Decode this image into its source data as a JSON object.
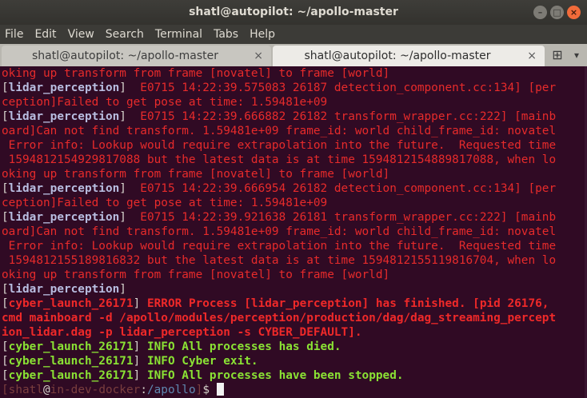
{
  "window": {
    "title": "shatl@autopilot: ~/apollo-master",
    "controls": {
      "minimize": "–",
      "maximize": "□",
      "close": "×"
    }
  },
  "menu": [
    "File",
    "Edit",
    "View",
    "Search",
    "Terminal",
    "Tabs",
    "Help"
  ],
  "tabs": [
    {
      "label": "shatl@autopilot: ~/apollo-master",
      "active": false
    },
    {
      "label": "shatl@autopilot: ~/apollo-master",
      "active": true
    }
  ],
  "tab_close_glyph": "×",
  "new_tab_glyph": "⊞",
  "tab_menu_glyph": "▾",
  "terminal": {
    "lines": [
      {
        "type": "red",
        "text": "oking up transform from frame [novatel] to frame [world]"
      },
      {
        "type": "tagged",
        "tag": "lidar_perception",
        "text": "  E0715 14:22:39.575083 26187 detection_component.cc:134] [per"
      },
      {
        "type": "red",
        "text": "ception]Failed to get pose at time: 1.59481e+09"
      },
      {
        "type": "tagged",
        "tag": "lidar_perception",
        "text": "  E0715 14:22:39.666882 26182 transform_wrapper.cc:222] [mainb"
      },
      {
        "type": "red",
        "text": "oard]Can not find transform. 1.59481e+09 frame_id: world child_frame_id: novatel"
      },
      {
        "type": "red",
        "text": " Error info: Lookup would require extrapolation into the future.  Requested time"
      },
      {
        "type": "red",
        "text": " 1594812154929817088 but the latest data is at time 1594812154889817088, when lo"
      },
      {
        "type": "red",
        "text": "oking up transform from frame [novatel] to frame [world]"
      },
      {
        "type": "tagged",
        "tag": "lidar_perception",
        "text": "  E0715 14:22:39.666954 26182 detection_component.cc:134] [per"
      },
      {
        "type": "red",
        "text": "ception]Failed to get pose at time: 1.59481e+09"
      },
      {
        "type": "tagged",
        "tag": "lidar_perception",
        "text": "  E0715 14:22:39.921638 26181 transform_wrapper.cc:222] [mainb"
      },
      {
        "type": "red",
        "text": "oard]Can not find transform. 1.59481e+09 frame_id: world child_frame_id: novatel"
      },
      {
        "type": "red",
        "text": " Error info: Lookup would require extrapolation into the future.  Requested time"
      },
      {
        "type": "red",
        "text": " 1594812155189816832 but the latest data is at time 1594812155119816704, when lo"
      },
      {
        "type": "red",
        "text": "oking up transform from frame [novatel] to frame [world]"
      },
      {
        "type": "tagonly",
        "tag": "lidar_perception"
      },
      {
        "type": "launch_err",
        "tag": "cyber_launch_26171",
        "text": " ERROR Process [lidar_perception] has finished. [pid 26176,"
      },
      {
        "type": "err",
        "text": "cmd mainboard -d /apollo/modules/perception/production/dag/dag_streaming_percept"
      },
      {
        "type": "err",
        "text": "ion_lidar.dag -p lidar_perception -s CYBER_DEFAULT]."
      },
      {
        "type": "launch_ok",
        "tag": "cyber_launch_26171",
        "text": " INFO All processes has died."
      },
      {
        "type": "launch_ok",
        "tag": "cyber_launch_26171",
        "text": " INFO Cyber exit."
      },
      {
        "type": "launch_ok",
        "tag": "cyber_launch_26171",
        "text": " INFO All processes have been stopped."
      }
    ],
    "prompt": {
      "user": "shatl",
      "host": "in-dev-docker",
      "path": "/apollo",
      "symbol": "$"
    }
  }
}
